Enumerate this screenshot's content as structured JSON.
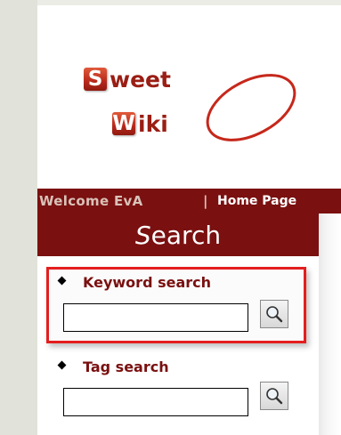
{
  "logo": {
    "letter1": "S",
    "rest1": "weet",
    "letter2": "W",
    "rest2": "iki",
    "brand_color": "#b8281b"
  },
  "header": {
    "welcome": "Welcome EvA",
    "separator": "|",
    "home_link": "Home Page"
  },
  "search_panel": {
    "title_initial": "S",
    "title_rest": "earch",
    "keyword": {
      "label": "Keyword search",
      "value": "",
      "button_icon": "magnifier-icon"
    },
    "tag": {
      "label": "Tag search",
      "value": "",
      "button_icon": "magnifier-icon"
    }
  },
  "colors": {
    "bar": "#7a1010",
    "highlight": "#e41e1e",
    "label": "#7a1010"
  }
}
